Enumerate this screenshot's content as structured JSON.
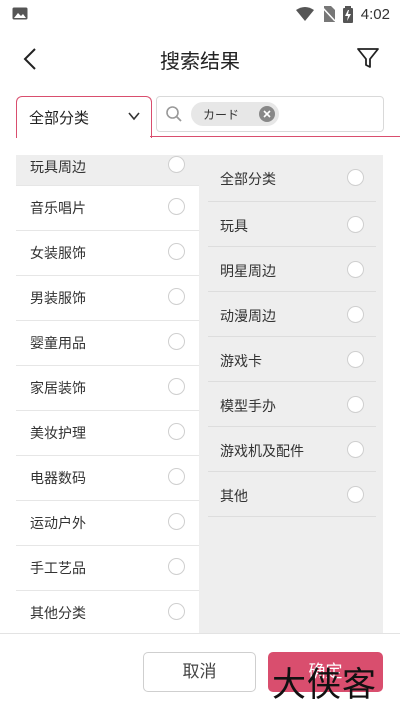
{
  "status_bar": {
    "time": "4:02"
  },
  "header": {
    "title": "搜索结果"
  },
  "search": {
    "category_selected": "全部分类",
    "chip_text": "カード"
  },
  "left_categories": [
    "玩具周边",
    "音乐唱片",
    "女装服饰",
    "男装服饰",
    "婴童用品",
    "家居装饰",
    "美妆护理",
    "电器数码",
    "运动户外",
    "手工艺品",
    "其他分类"
  ],
  "right_subcategories": [
    "全部分类",
    "玩具",
    "明星周边",
    "动漫周边",
    "游戏卡",
    "模型手办",
    "游戏机及配件",
    "其他"
  ],
  "buttons": {
    "cancel": "取消",
    "confirm": "确定"
  },
  "watermark": "大侠客",
  "colors": {
    "accent": "#d94e6e"
  }
}
